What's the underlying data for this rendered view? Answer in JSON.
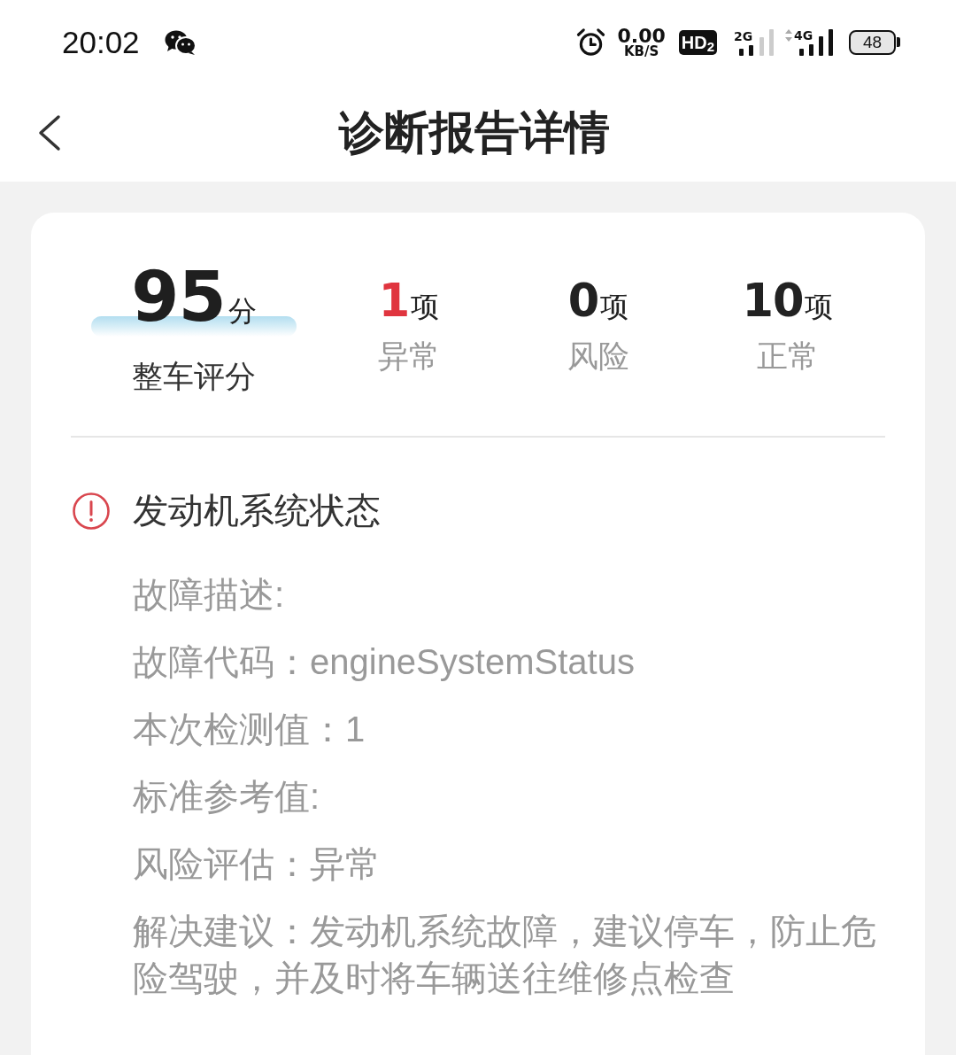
{
  "status_bar": {
    "time": "20:02",
    "network_speed": "0.00",
    "network_speed_unit": "KB/S",
    "hd_badge": "HD$_{2}$",
    "sim1_network": "2G",
    "sim2_network": "4G",
    "battery": "48"
  },
  "nav": {
    "title": "诊断报告详情"
  },
  "summary": {
    "score": "95",
    "score_unit": "分",
    "score_label": "整车评分",
    "stats": [
      {
        "count": "1",
        "unit": "项",
        "label": "异常",
        "color": "#e0353f"
      },
      {
        "count": "0",
        "unit": "项",
        "label": "风险",
        "color": "#222222"
      },
      {
        "count": "10",
        "unit": "项",
        "label": "正常",
        "color": "#222222"
      }
    ]
  },
  "section": {
    "title": "发动机系统状态",
    "details": [
      {
        "label": "故障描述:"
      },
      {
        "label": "故障代码：",
        "value": "engineSystemStatus"
      },
      {
        "label": "本次检测值：",
        "value": "1"
      },
      {
        "label": "标准参考值:"
      },
      {
        "label": "风险评估：",
        "value": "异常"
      },
      {
        "label": "解决建议：",
        "value": "发动机系统故障，建议停车，防止危险驾驶，并及时将车辆送往维修点检查"
      }
    ]
  }
}
